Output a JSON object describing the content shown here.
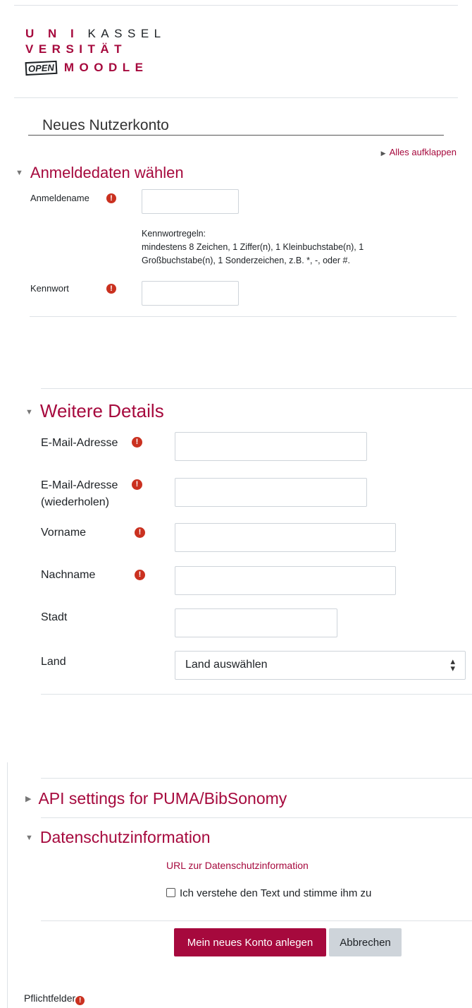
{
  "logo": {
    "row1": {
      "bold": "U N I",
      "rest": "KASSEL"
    },
    "row2": {
      "text": "VERSITÄT"
    },
    "row3": {
      "badge": "OPEN",
      "rest": "MOODLE"
    }
  },
  "page_title": "Neues Nutzerkonto",
  "expand_all": "Alles aufklappen",
  "sections": {
    "login": {
      "title": "Anmeldedaten wählen",
      "username_label": "Anmeldename",
      "password_rules_title": "Kennwortregeln:",
      "password_rules_text": "mindestens 8 Zeichen, 1 Ziffer(n), 1 Kleinbuchstabe(n), 1 Großbuchstabe(n), 1 Sonderzeichen, z.B. *, -, oder #.",
      "password_label": "Kennwort"
    },
    "details": {
      "title": "Weitere Details",
      "email_label": "E-Mail-Adresse",
      "email_repeat_label_1": "E-Mail-Adresse",
      "email_repeat_label_2": "(wiederholen)",
      "firstname_label": "Vorname",
      "lastname_label": "Nachname",
      "city_label": "Stadt",
      "country_label": "Land",
      "country_selected": "Land auswählen"
    },
    "puma": {
      "title": "API settings for PUMA/BibSonomy"
    },
    "privacy": {
      "title": "Datenschutzinformation",
      "link": "URL zur Datenschutzinformation",
      "checkbox_label": "Ich verstehe den Text und stimme ihm zu"
    }
  },
  "buttons": {
    "submit": "Mein neues Konto anlegen",
    "cancel": "Abbrechen"
  },
  "required_note": "Pflichtfelder",
  "required_icon": "!",
  "colors": {
    "accent": "#a6093d",
    "required": "#ca3120",
    "cancel_bg": "#ced4da"
  }
}
